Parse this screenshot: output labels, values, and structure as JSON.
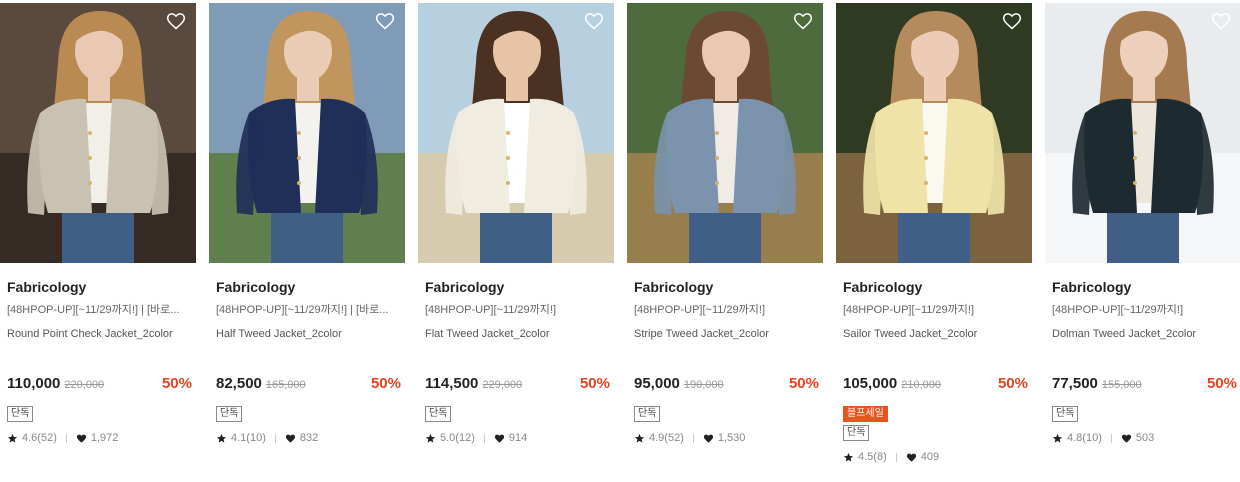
{
  "products": [
    {
      "brand": "Fabricology",
      "promo": "[48HPOP-UP][~11/29까지!] | [바로...",
      "name": "Round Point Check Jacket_2color",
      "price": "110,000",
      "orig": "220,000",
      "discount": "50%",
      "badge_exclusive": "단독",
      "badge_fire": "",
      "rating": "4.6(52)",
      "likes": "1,972",
      "palette": {
        "bg": "#5a4a3e",
        "bg2": "#2f2620",
        "hair": "#b98a52",
        "coat": "#c9c2b3",
        "inner": "#f2efe9",
        "skin": "#e9c9b3"
      }
    },
    {
      "brand": "Fabricology",
      "promo": "[48HPOP-UP][~11/29까지!] | [바로...",
      "name": "Half Tweed Jacket_2color",
      "price": "82,500",
      "orig": "165,000",
      "discount": "50%",
      "badge_exclusive": "단독",
      "badge_fire": "",
      "rating": "4.1(10)",
      "likes": "832",
      "palette": {
        "bg": "#7f9bb8",
        "bg2": "#5b7a3c",
        "hair": "#c1955e",
        "coat": "#1f2f58",
        "inner": "#f3f2ef",
        "skin": "#eacbb5"
      }
    },
    {
      "brand": "Fabricology",
      "promo": "[48HPOP-UP][~11/29까지!]",
      "name": "Flat Tweed Jacket_2color",
      "price": "114,500",
      "orig": "229,000",
      "discount": "50%",
      "badge_exclusive": "단독",
      "badge_fire": "",
      "rating": "5.0(12)",
      "likes": "914",
      "palette": {
        "bg": "#b7d0e0",
        "bg2": "#dcc9a6",
        "hair": "#4a3122",
        "coat": "#f1ece0",
        "inner": "#ffffff",
        "skin": "#e7c4a8"
      }
    },
    {
      "brand": "Fabricology",
      "promo": "[48HPOP-UP][~11/29까지!]",
      "name": "Stripe Tweed Jacket_2color",
      "price": "95,000",
      "orig": "190,000",
      "discount": "50%",
      "badge_exclusive": "단독",
      "badge_fire": "",
      "rating": "4.9(52)",
      "likes": "1,530",
      "palette": {
        "bg": "#4d6b3c",
        "bg2": "#a3824f",
        "hair": "#6a4a33",
        "coat": "#7b93ad",
        "inner": "#f0ece5",
        "skin": "#e9c9b1"
      }
    },
    {
      "brand": "Fabricology",
      "promo": "[48HPOP-UP][~11/29까지!]",
      "name": "Sailor Tweed Jacket_2color",
      "price": "105,000",
      "orig": "210,000",
      "discount": "50%",
      "badge_exclusive": "단독",
      "badge_fire": "블프세일",
      "rating": "4.5(8)",
      "likes": "409",
      "palette": {
        "bg": "#2f3a22",
        "bg2": "#8a6a44",
        "hair": "#b58a5c",
        "coat": "#efe3a8",
        "inner": "#fbf8ef",
        "skin": "#ecccb6"
      }
    },
    {
      "brand": "Fabricology",
      "promo": "[48HPOP-UP][~11/29까지!]",
      "name": "Dolman Tweed Jacket_2color",
      "price": "77,500",
      "orig": "155,000",
      "discount": "50%",
      "badge_exclusive": "단독",
      "badge_fire": "",
      "rating": "4.8(10)",
      "likes": "503",
      "palette": {
        "bg": "#e9ecee",
        "bg2": "#f7f8f8",
        "hair": "#a57a4e",
        "coat": "#1d2a30",
        "inner": "#ece7dc",
        "skin": "#ecd0bc"
      }
    }
  ]
}
